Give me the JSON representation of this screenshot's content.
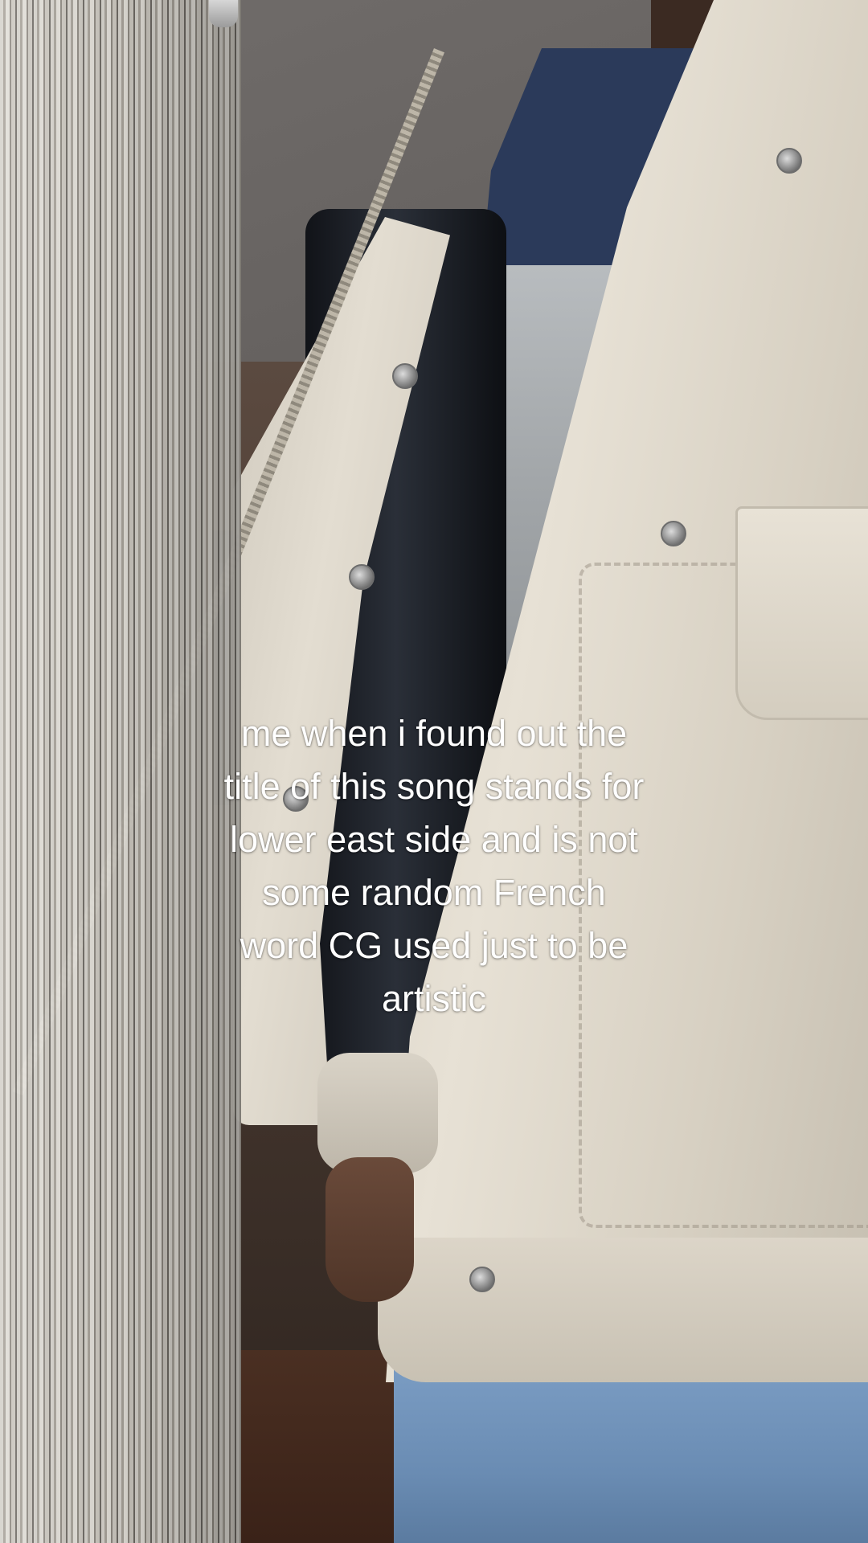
{
  "photo": {
    "description_icon": "photo-scene",
    "caption": "me when i found out the\ntitle of this song stands for\nlower east side and is not\nsome random French\nword CG used just to be\nartistic"
  }
}
